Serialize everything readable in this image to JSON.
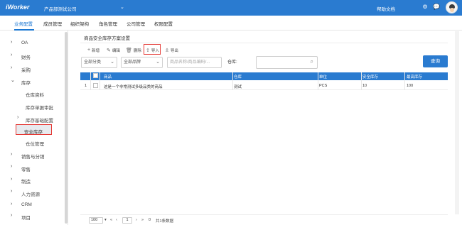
{
  "app": {
    "logo": "iWorker",
    "company": "产品部测试公司",
    "help": "帮助文档",
    "icons": [
      "chevron-down-icon",
      "gear-icon",
      "chat-icon",
      "avatar"
    ]
  },
  "subnav": {
    "tabs": [
      {
        "label": "业务配置",
        "active": true
      },
      {
        "label": "成员管理",
        "active": false
      },
      {
        "label": "组织架构",
        "active": false
      },
      {
        "label": "角色管理",
        "active": false
      },
      {
        "label": "公司管理",
        "active": false
      },
      {
        "label": "权限配置",
        "active": false
      }
    ]
  },
  "sidebar": {
    "items": [
      {
        "label": "OA",
        "caret": "›"
      },
      {
        "label": "财务",
        "caret": "›"
      },
      {
        "label": "采购",
        "caret": "›"
      },
      {
        "label": "库存",
        "caret": "⌄"
      },
      {
        "label": "仓库资料",
        "caret": ""
      },
      {
        "label": "库存单据审批",
        "caret": ""
      },
      {
        "label": "库存基础配置",
        "caret": "›"
      },
      {
        "label": "安全库存",
        "caret": ""
      },
      {
        "label": "仓位管理",
        "caret": ""
      },
      {
        "label": "销售与分销",
        "caret": "›"
      },
      {
        "label": "零售",
        "caret": "›"
      },
      {
        "label": "制造",
        "caret": "›"
      },
      {
        "label": "人力资源",
        "caret": "›"
      },
      {
        "label": "CRM",
        "caret": "›"
      },
      {
        "label": "项目",
        "caret": "›"
      }
    ]
  },
  "main": {
    "section_title": "商品安全库存方案设置",
    "toolbar": {
      "add": "新增",
      "edit": "编辑",
      "delete": "删除",
      "import": "导入",
      "export": "导出"
    },
    "filters": {
      "category": "全部分类",
      "brand": "全部品牌",
      "search_placeholder": "商品名称/商品编码/...",
      "warehouse_label": "仓库:",
      "query_button": "查询"
    },
    "table": {
      "columns": [
        "商品",
        "仓库",
        "单位",
        "安全库存",
        "最高库存"
      ],
      "rows": [
        {
          "index": "1",
          "product": "这是一个非常测试多级品类的商品",
          "warehouse": "测试",
          "unit": "PCS",
          "safety": "10",
          "max": "100"
        }
      ]
    },
    "pager": {
      "page_size": "100",
      "current_page": "1",
      "total_pages": "0",
      "total_text": "共1条数据"
    }
  },
  "colors": {
    "primary": "#2a7bd0",
    "highlight_border": "#e53935"
  }
}
